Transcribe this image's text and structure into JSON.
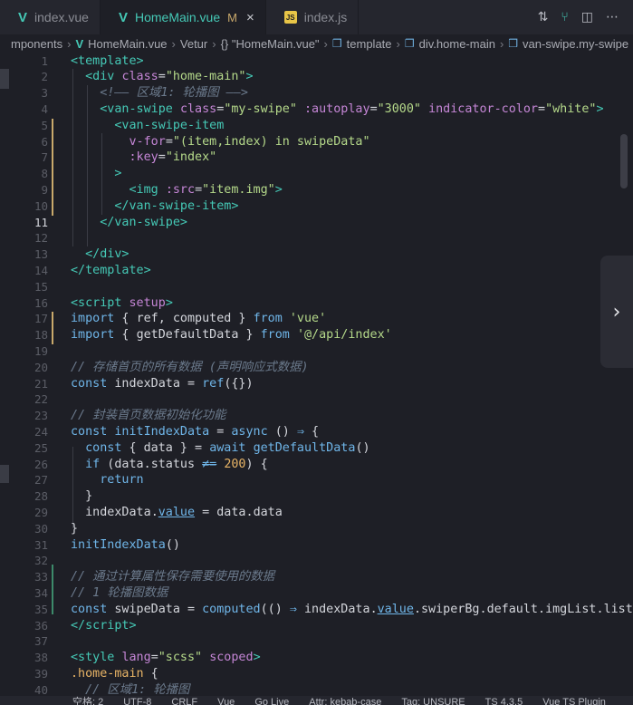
{
  "tabs": [
    {
      "label": "index.vue",
      "type": "vue",
      "active": false,
      "modified": "",
      "close": ""
    },
    {
      "label": "HomeMain.vue",
      "type": "vue",
      "active": true,
      "modified": "M",
      "close": "×"
    },
    {
      "label": "index.js",
      "type": "js",
      "active": false,
      "modified": "",
      "close": ""
    }
  ],
  "tab_actions": [
    "compare-icon",
    "branch-icon",
    "split-editor-icon",
    "more-icon"
  ],
  "breadcrumb": {
    "parts": [
      "mponents",
      "HomeMain.vue",
      "Vetur",
      "{} \"HomeMain.vue\"",
      "template",
      "div.home-main",
      "van-swipe.my-swipe"
    ]
  },
  "editor": {
    "current_line": 11,
    "lines": [
      {
        "n": "1",
        "html": "<span class='t'>&lt;template&gt;</span>"
      },
      {
        "n": "2",
        "html": "  <span class='t'>&lt;div</span> <span class='a'>class</span>=<span class='s'>\"home-main\"</span><span class='t'>&gt;</span>"
      },
      {
        "n": "3",
        "html": "    <span class='c'>&lt;!—— 区域1: 轮播图 ——&gt;</span>"
      },
      {
        "n": "4",
        "html": "    <span class='t'>&lt;van-swipe</span> <span class='a'>class</span>=<span class='s'>\"my-swipe\"</span> <span class='a'>:autoplay</span>=<span class='s'>\"3000\"</span> <span class='a'>indicator-color</span>=<span class='s'>\"white\"</span><span class='t'>&gt;</span>"
      },
      {
        "n": "5",
        "html": "      <span class='t'>&lt;van-swipe-item</span>"
      },
      {
        "n": "6",
        "html": "        <span class='a'>v-for</span>=<span class='s'>\"(item,index) in swipeData\"</span>"
      },
      {
        "n": "7",
        "html": "        <span class='a'>:key</span>=<span class='s'>\"index\"</span>"
      },
      {
        "n": "8",
        "html": "      <span class='t'>&gt;</span>"
      },
      {
        "n": "9",
        "html": "        <span class='t'>&lt;img</span> <span class='a'>:src</span>=<span class='s'>\"item.img\"</span><span class='t'>&gt;</span>"
      },
      {
        "n": "10",
        "html": "      <span class='t'>&lt;/van-swipe-item&gt;</span>"
      },
      {
        "n": "11",
        "html": "    <span class='t'>&lt;/van-swipe&gt;</span>"
      },
      {
        "n": "12",
        "html": ""
      },
      {
        "n": "13",
        "html": "  <span class='t'>&lt;/div&gt;</span>"
      },
      {
        "n": "14",
        "html": "<span class='t'>&lt;/template&gt;</span>"
      },
      {
        "n": "15",
        "html": ""
      },
      {
        "n": "16",
        "html": "<span class='t'>&lt;script</span> <span class='a'>setup</span><span class='t'>&gt;</span>"
      },
      {
        "n": "17",
        "html": "<span class='k'>import</span> { <span class='v'>ref</span>, <span class='v'>computed</span> } <span class='k'>from</span> <span class='s'>'vue'</span>"
      },
      {
        "n": "18",
        "html": "<span class='k'>import</span> { <span class='v'>getDefaultData</span> } <span class='k'>from</span> <span class='s'>'@/api/index'</span>"
      },
      {
        "n": "19",
        "html": ""
      },
      {
        "n": "20",
        "html": "<span class='c'>// 存储首页的所有数据 (声明响应式数据)</span>"
      },
      {
        "n": "21",
        "html": "<span class='k'>const</span> <span class='v'>indexData</span> = <span class='f'>ref</span>({})"
      },
      {
        "n": "22",
        "html": ""
      },
      {
        "n": "23",
        "html": "<span class='c'>// 封装首页数据初始化功能</span>"
      },
      {
        "n": "24",
        "html": "<span class='k'>const</span> <span class='f'>initIndexData</span> = <span class='k'>async</span> () <span class='k'>⇒</span> {"
      },
      {
        "n": "25",
        "html": "  <span class='k'>const</span> { <span class='v'>data</span> } = <span class='k'>await</span> <span class='f'>getDefaultData</span>()"
      },
      {
        "n": "26",
        "html": "  <span class='k'>if</span> (<span class='v'>data</span>.<span class='v'>status</span> <span class='strike'>≠=</span> <span class='n'>200</span>) {"
      },
      {
        "n": "27",
        "html": "    <span class='k'>return</span>"
      },
      {
        "n": "28",
        "html": "  }"
      },
      {
        "n": "29",
        "html": "  <span class='v'>indexData</span>.<span class='u'>value</span> = <span class='v'>data</span>.<span class='v'>data</span>"
      },
      {
        "n": "30",
        "html": "}"
      },
      {
        "n": "31",
        "html": "<span class='f'>initIndexData</span>()"
      },
      {
        "n": "32",
        "html": ""
      },
      {
        "n": "33",
        "html": "<span class='c'>// 通过计算属性保存需要使用的数据</span>"
      },
      {
        "n": "34",
        "html": "<span class='c'>// 1 轮播图数据</span>"
      },
      {
        "n": "35",
        "html": "<span class='k'>const</span> <span class='v'>swipeData</span> = <span class='f'>computed</span>(() <span class='k'>⇒</span> <span class='v'>indexData</span>.<span class='u'>value</span>.<span class='v'>swiperBg</span>.<span class='v'>default</span>.<span class='v'>imgList</span>.<span class='v'>list</span>"
      },
      {
        "n": "36",
        "html": "<span class='t'>&lt;/script&gt;</span>"
      },
      {
        "n": "37",
        "html": ""
      },
      {
        "n": "38",
        "html": "<span class='t'>&lt;style</span> <span class='a'>lang</span>=<span class='s'>\"scss\"</span> <span class='a'>scoped</span><span class='t'>&gt;</span>"
      },
      {
        "n": "39",
        "html": "<span class='n'>.home-main</span> {"
      },
      {
        "n": "40",
        "html": "  <span class='c'>// 区域1: 轮播图</span>"
      }
    ]
  },
  "next_button_label": "›",
  "statusbar": {
    "items": [
      "空格: 2",
      "UTF-8",
      "CRLF",
      "Vue",
      "Go Live",
      "Attr: kebab-case",
      "Tag: UNSURE",
      "TS 4.3.5",
      "Vue TS Plugin"
    ]
  },
  "colors": {
    "background": "#1e1f26",
    "tag": "#45c9b6",
    "attribute": "#c586d6",
    "string": "#b5d98a",
    "keyword": "#6fb5e8",
    "comment": "#6b7a8c"
  }
}
